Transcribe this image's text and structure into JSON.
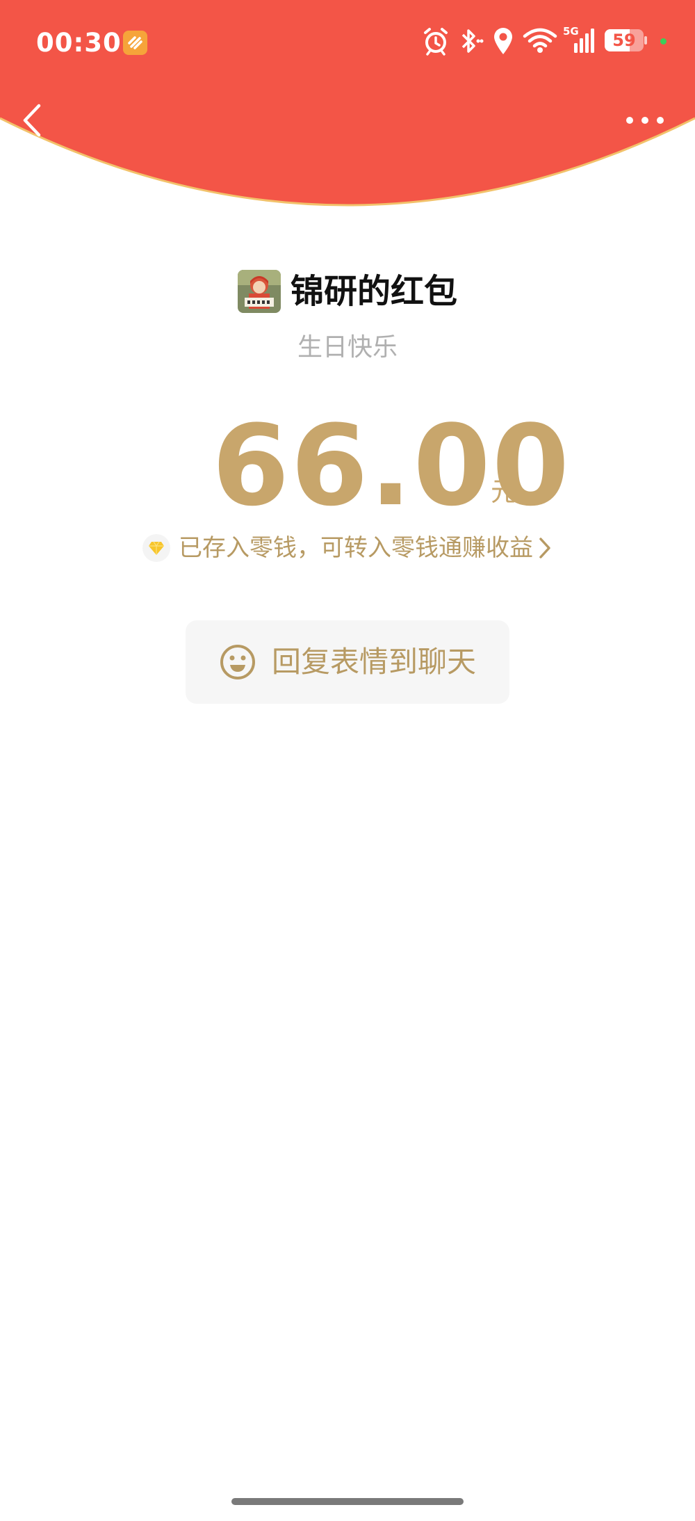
{
  "status_bar": {
    "time": "00:30",
    "network": "5G",
    "battery": "59"
  },
  "header": {
    "back_icon": "chevron-left-icon",
    "more_icon": "more-horizontal-icon",
    "color": "#f35547"
  },
  "envelope": {
    "sender_name": "锦研的红包",
    "greeting": "生日快乐",
    "amount": "66.00",
    "unit": "元",
    "wallet_note": "已存入零钱，可转入零钱通赚收益",
    "accent_color": "#c8a66c"
  },
  "actions": {
    "reply_label": "回复表情到聊天"
  }
}
